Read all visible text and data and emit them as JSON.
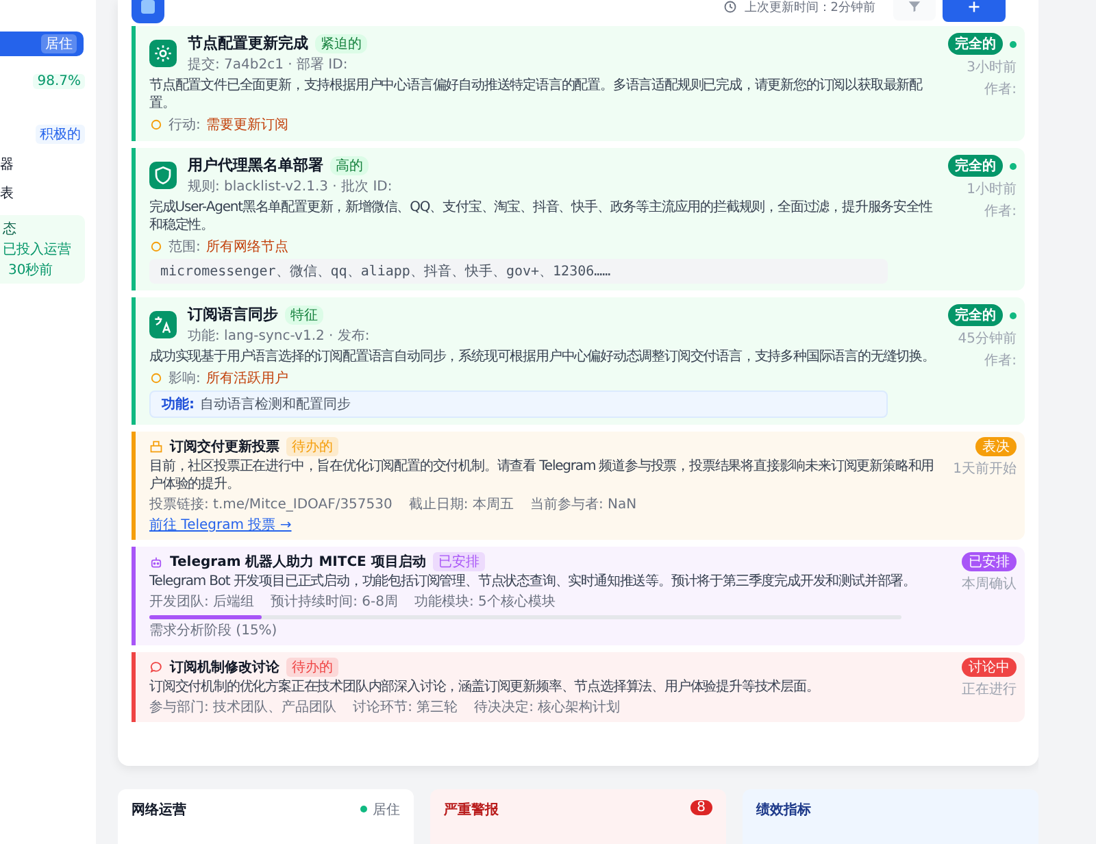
{
  "sidebar": {
    "items": [
      {
        "kind": "active",
        "badge": "居住",
        "selected": true
      },
      {
        "kind": "stat",
        "badge": "98.7%"
      },
      {
        "kind": "stat",
        "badge": "积极的"
      },
      {
        "kind": "label",
        "label": "器"
      },
      {
        "kind": "label",
        "label": "表"
      },
      {
        "kind": "status",
        "lines": [
          "态",
          "已投入运营",
          "30秒前"
        ]
      }
    ]
  },
  "header": {
    "last_update": "上次更新时间：2分钟前"
  },
  "updates": [
    {
      "title": "节点配置更新完成",
      "tag": "紧迫的",
      "meta": "提交: 7a4b2c1 · 部署 ID:",
      "description": "节点配置文件已全面更新，支持根据用户中心语言偏好自动推送特定语言的配置。多语言适配规则已完成，请更新您的订阅以获取最新配置。",
      "footer_label": "行动:",
      "footer_value": "需要更新订阅",
      "status": "完全的",
      "time": "3小时前",
      "author_label": "作者:"
    },
    {
      "title": "用户代理黑名单部署",
      "tag": "高的",
      "meta": "规则: blacklist-v2.1.3 · 批次 ID:",
      "description": "完成User-Agent黑名单配置更新，新增微信、QQ、支付宝、淘宝、抖音、快手、政务等主流应用的拦截规则，全面过滤，提升服务安全性和稳定性。",
      "footer_label": "范围:",
      "footer_value": "所有网络节点",
      "code": "micromessenger、微信、qq、aliapp、抖音、快手、gov+、12306……",
      "status": "完全的",
      "time": "1小时前",
      "author_label": "作者:"
    },
    {
      "title": "订阅语言同步",
      "tag": "特征",
      "meta": "功能: lang-sync-v1.2 · 发布:",
      "description": "成功实现基于用户语言选择的订阅配置语言自动同步，系统现可根据用户中心偏好动态调整订阅交付语言，支持多种国际语言的无缝切换。",
      "footer_label": "影响:",
      "footer_value": "所有活跃用户",
      "feature_label": "功能:",
      "feature_text": "自动语言检测和配置同步",
      "status": "完全的",
      "time": "45分钟前",
      "author_label": "作者:"
    }
  ],
  "notices": [
    {
      "color": "#f59e0b",
      "title": "订阅交付更新投票",
      "tag": "待办的",
      "description": "目前，社区投票正在进行中，旨在优化订阅配置的交付机制。请查看 Telegram 频道参与投票，投票结果将直接影响未来订阅更新策略和用户体验的提升。",
      "meta": [
        "投票链接: t.me/Mitce_IDOAF/357530",
        "截止日期: 本周五",
        "当前参与者: NaN"
      ],
      "link": "前往 Telegram 投票 →",
      "status": "表决",
      "time": "1天前开始"
    },
    {
      "color": "#a855f7",
      "title": "Telegram 机器人助力 MITCE 项目启动",
      "tag": "已安排",
      "description": "Telegram Bot 开发项目已正式启动，功能包括订阅管理、节点状态查询、实时通知推送等。预计将于第三季度完成开发和测试并部署。",
      "meta": [
        "开发团队: 后端组",
        "预计持续时间: 6-8周",
        "功能模块: 5个核心模块"
      ],
      "level": 0.15,
      "progress_label": "需求分析阶段 (15%)",
      "status": "已安排",
      "time": "本周确认"
    },
    {
      "color": "#ef4444",
      "title": "订阅机制修改讨论",
      "tag": "待办的",
      "description": "订阅交付机制的优化方案正在技术团队内部深入讨论，涵盖订阅更新频率、节点选择算法、用户体验提升等技术层面。",
      "meta": [
        "参与部门: 技术团队、产品团队",
        "讨论环节: 第三轮",
        "待决决定: 核心架构计划"
      ],
      "status": "讨论中",
      "time": "正在进行"
    }
  ],
  "bottom_cards": [
    {
      "kind": "network",
      "title": "网络运营",
      "status": "居住"
    },
    {
      "kind": "alert",
      "title": "严重警报",
      "count": "8"
    },
    {
      "kind": "metrics",
      "title": "绩效指标"
    }
  ]
}
